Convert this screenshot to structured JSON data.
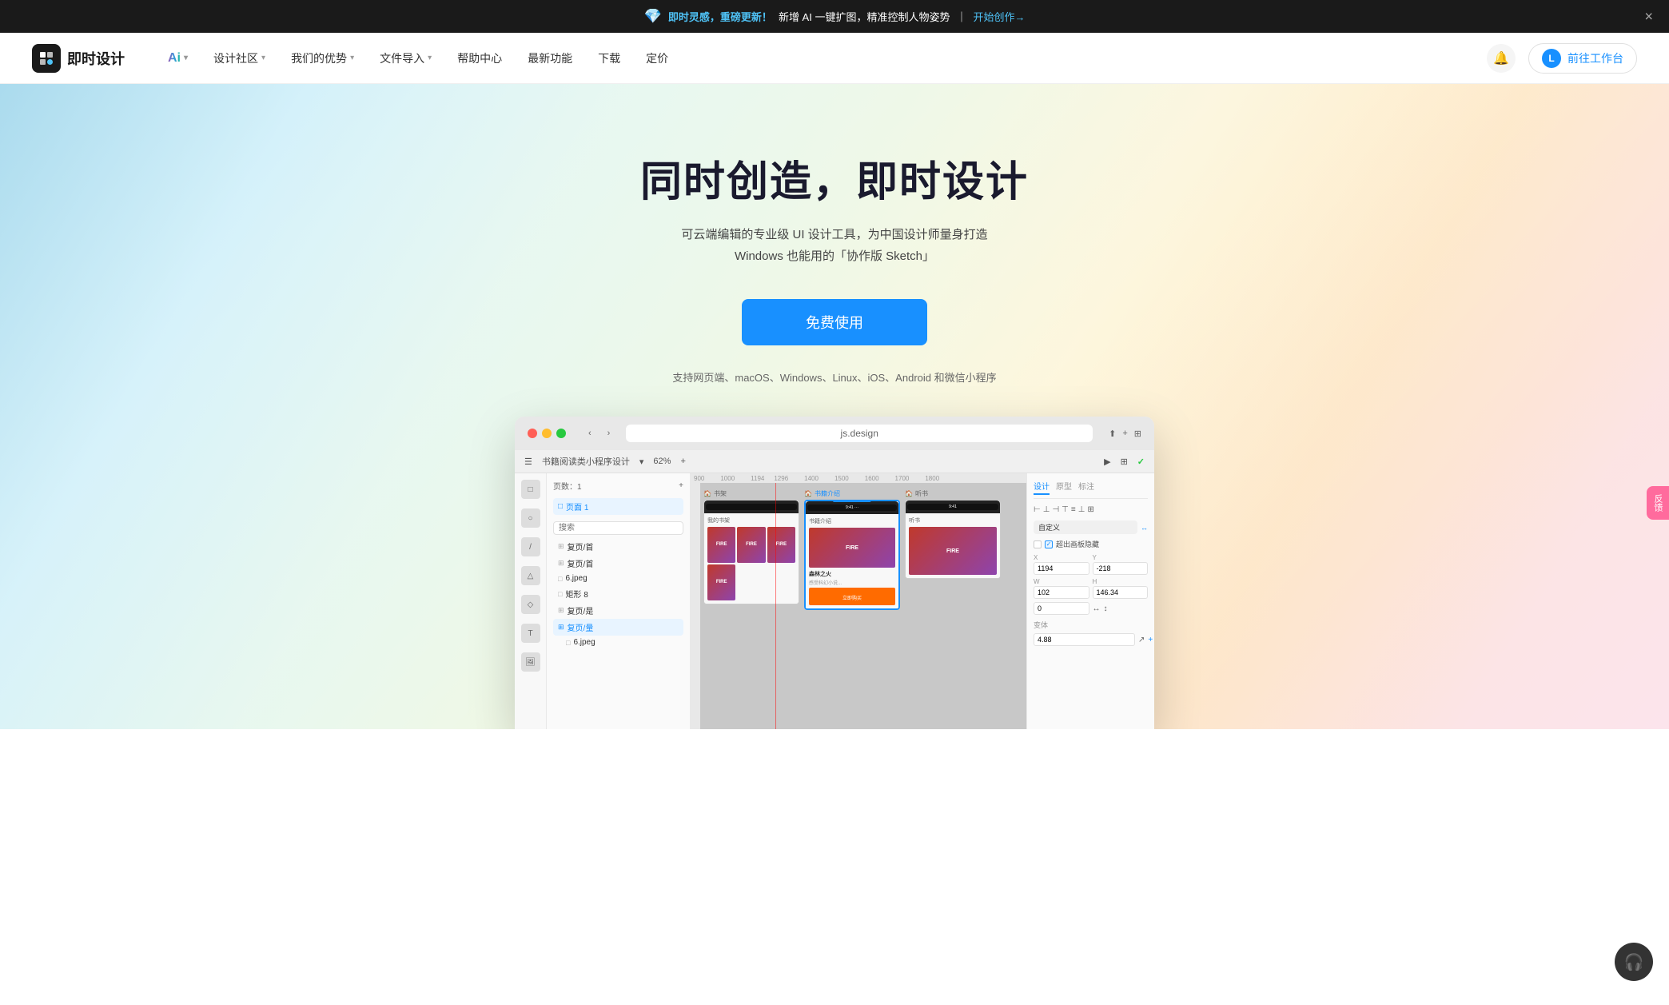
{
  "banner": {
    "icon_label": "prism-icon",
    "highlight_text": "即时灵感，重磅更新！",
    "body_text": "新增 AI 一键扩图，精准控制人物姿势",
    "separator": "｜",
    "cta_text": "开始创作→",
    "close_label": "×"
  },
  "navbar": {
    "logo_text": "即时设计",
    "logo_icon_label": "logo-icon",
    "nav_items": [
      {
        "label": "Ai",
        "has_dropdown": true,
        "is_ai": true
      },
      {
        "label": "设计社区",
        "has_dropdown": true
      },
      {
        "label": "我们的优势",
        "has_dropdown": true
      },
      {
        "label": "文件导入",
        "has_dropdown": true
      },
      {
        "label": "帮助中心",
        "has_dropdown": false
      },
      {
        "label": "最新功能",
        "has_dropdown": false
      },
      {
        "label": "下载",
        "has_dropdown": false
      },
      {
        "label": "定价",
        "has_dropdown": false
      }
    ],
    "bell_label": "🔔",
    "user_avatar": "L",
    "goto_text": "前往工作台"
  },
  "hero": {
    "title": "同时创造，即时设计",
    "subtitle_line1": "可云端编辑的专业级 UI 设计工具，为中国设计师量身打造",
    "subtitle_line2": "Windows 也能用的「协作版 Sketch」",
    "cta_label": "免费使用",
    "platforms": "支持网页端、macOS、Windows、Linux、iOS、Android 和微信小程序"
  },
  "app_window": {
    "title_bar": {
      "dot_red": "red",
      "dot_yellow": "yellow",
      "dot_green": "green",
      "nav_back": "‹",
      "nav_forward": "›",
      "address": "js.design",
      "project_name": "书籍阅读类小程序设计"
    },
    "left_panel": {
      "header": "页数：1",
      "page_item": "页面 1",
      "search_placeholder": "搜索",
      "layers": [
        {
          "label": "复页/首",
          "icon": "⊞",
          "active": false
        },
        {
          "label": "复页/首",
          "icon": "⊞",
          "active": false
        },
        {
          "label": "6.jpeg",
          "icon": "□",
          "active": false
        },
        {
          "label": "矩形 8",
          "icon": "□",
          "active": false
        },
        {
          "label": "复页/是",
          "icon": "⊞",
          "active": false
        },
        {
          "label": "复页/量",
          "icon": "⊞",
          "active": true
        },
        {
          "label": "6.jpeg",
          "icon": "□",
          "active": false
        }
      ]
    },
    "canvas": {
      "frames": [
        {
          "label": "书架",
          "content_label": "书籍介绍",
          "has_selection": true
        },
        {
          "label": "书架",
          "content_label": "书籍介绍"
        },
        {
          "label": "听书"
        }
      ]
    },
    "right_panel": {
      "tabs": [
        "设计",
        "原型",
        "标注"
      ],
      "active_tab": "设计",
      "x_label": "X",
      "x_value": "1194",
      "y_label": "Y",
      "y_value": "-218",
      "w_label": "W",
      "w_value": "102",
      "h_label": "H",
      "h_value": "146.34",
      "rotation": "0",
      "dropdown_label": "自定义",
      "overflow_label": "超出画板隐藏",
      "value_label": "4.88"
    }
  },
  "floating": {
    "feedback_label": "反馈",
    "headset_label": "🎧"
  }
}
